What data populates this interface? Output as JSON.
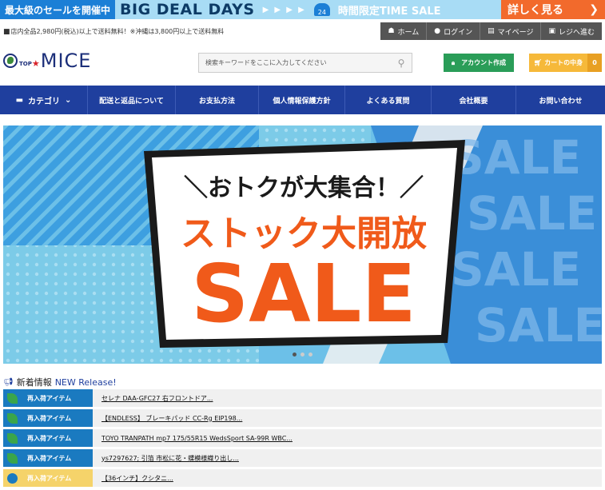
{
  "promo": {
    "left_text": "最大級のセールを開催中",
    "big_text": "BIG DEAL DAYS",
    "arrows": "▶ ▶ ▶ ▶",
    "badge_text": "24",
    "time_text": "時間限定TIME SALE",
    "cta_label": "詳しく見る",
    "cta_icon": "chevron-right-icon"
  },
  "utility": {
    "shipping_note": "店内全品2,980円(税込)以上で送料無料！※沖縄は3,800円以上で送料無料",
    "nav": [
      {
        "label": "ホーム",
        "icon": "home-icon"
      },
      {
        "label": "ログイン",
        "icon": "user-icon"
      },
      {
        "label": "マイページ",
        "icon": "id-card-icon"
      },
      {
        "label": "レジへ進む",
        "icon": "register-icon"
      }
    ]
  },
  "header": {
    "logo_top": "TOP",
    "logo_name": "MICE",
    "search_placeholder": "検索キーワードをここに入力してください",
    "account_label": "アカウント作成",
    "cart_label": "カートの中身",
    "cart_count": "0"
  },
  "mainnav": {
    "category_label": "カテゴリ",
    "items": [
      "配送と返品について",
      "お支払方法",
      "個人情報保護方針",
      "よくある質問",
      "会社概要",
      "お問い合わせ"
    ]
  },
  "hero": {
    "line1": "＼おトクが大集合！／",
    "line2": "ストック大開放",
    "line3": "SALE",
    "bg_word": "SALE",
    "slide_count": 3,
    "active_slide": 1,
    "colors": {
      "blue": "#1b7fd6",
      "light_blue": "#6cc0e8",
      "orange": "#f05a1a"
    }
  },
  "news": {
    "title": "新着情報",
    "title_en": "NEW Release!",
    "rows": [
      {
        "tag": "再入荷アイテム",
        "text": "セレナ DAA-GFC27 右フロントドア...",
        "style": "blue"
      },
      {
        "tag": "再入荷アイテム",
        "text": "【ENDLESS】 ブレーキパッド CC-Rg EIP198...",
        "style": "blue"
      },
      {
        "tag": "再入荷アイテム",
        "text": "TOYO TRANPATH mp7 175/55R15 WedsSport SA-99R WBC...",
        "style": "blue"
      },
      {
        "tag": "再入荷アイテム",
        "text": "ys7297627; 引箔 市松に花・蝶模様織り出し...",
        "style": "blue"
      },
      {
        "tag": "再入荷アイテム",
        "text": "【36インチ】クシタニ...",
        "style": "yellow"
      }
    ]
  }
}
